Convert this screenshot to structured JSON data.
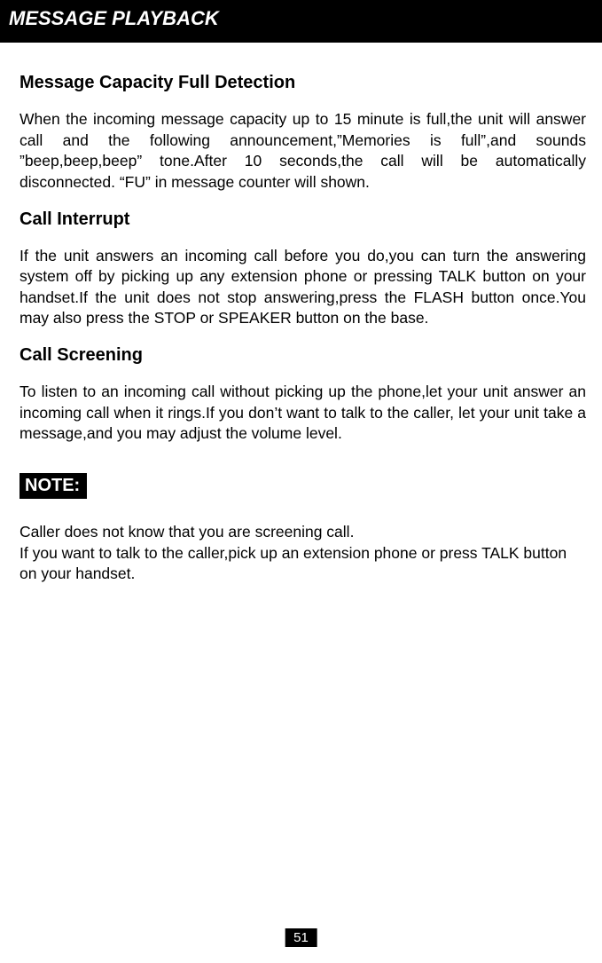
{
  "header": {
    "title": "MESSAGE PLAYBACK"
  },
  "sections": {
    "s1": {
      "heading": "Message Capacity Full Detection",
      "body": " When the incoming message capacity up to 15 minute is full,the unit will answer call and the following announcement,”Memories is full”,and sounds ”beep,beep,beep” tone.After 10 seconds,the call will be automatically disconnected. “FU” in message counter will shown."
    },
    "s2": {
      "heading": "Call Interrupt",
      "body": " If the unit answers an incoming call before you do,you can turn the answering system off by picking up any extension phone or pressing TALK button on your handset.If the unit does not stop answering,press the FLASH button once.You may also press the STOP or SPEAKER  button on the base."
    },
    "s3": {
      "heading": "Call Screening",
      "body": "To listen to an incoming call without picking up the phone,let your unit answer an incoming call when it rings.If you don’t want to talk to the caller, let your unit take a message,and you may adjust the volume level."
    },
    "note": {
      "label": "NOTE:",
      "body": " Caller does not know that you are screening call.\n If you want to talk to the caller,pick up an extension phone or press TALK button on your handset."
    }
  },
  "page_number": "51"
}
